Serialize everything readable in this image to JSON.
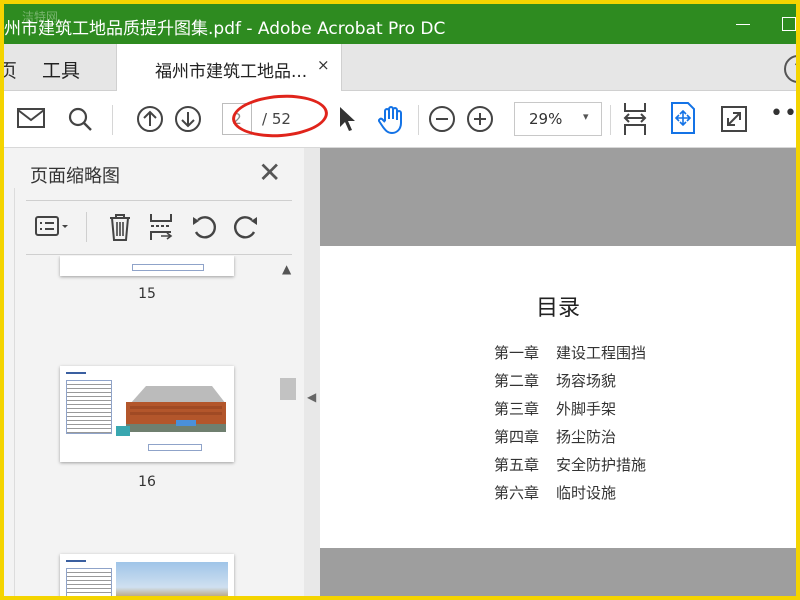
{
  "window": {
    "title": "州市建筑工地品质提升图集.pdf - Adobe Acrobat Pro DC",
    "watermark": "洁特网"
  },
  "tabs": {
    "home_label": "页",
    "tools_label": "工具",
    "doc_tab_label": "福州市建筑工地品...",
    "close_glyph": "×",
    "help_glyph": "?"
  },
  "toolbar": {
    "page_current": "2",
    "page_total": "/ 52",
    "zoom": "29%",
    "zoom_arrow": "▾",
    "more": "•••"
  },
  "panel": {
    "title": "页面缩略图",
    "close_glyph": "✕",
    "scroll_up": "▲",
    "thumbnails": [
      {
        "page": "15"
      },
      {
        "page": "16"
      },
      {
        "page": ""
      }
    ]
  },
  "document": {
    "toc_title": "目录",
    "toc": [
      {
        "chapter": "第一章",
        "name": "建设工程围挡"
      },
      {
        "chapter": "第二章",
        "name": "场容场貌"
      },
      {
        "chapter": "第三章",
        "name": "外脚手架"
      },
      {
        "chapter": "第四章",
        "name": "扬尘防治"
      },
      {
        "chapter": "第五章",
        "name": "安全防护措施"
      },
      {
        "chapter": "第六章",
        "name": "临时设施"
      }
    ],
    "collapse_arrow": "◀"
  },
  "colors": {
    "titlebar": "#2e8b20",
    "annotation": "#e0241b",
    "accent_icon": "#1473e6",
    "screen_border": "#f4d400"
  }
}
